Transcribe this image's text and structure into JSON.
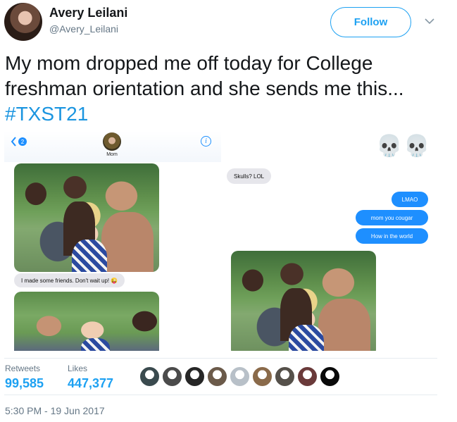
{
  "user": {
    "display_name": "Avery Leilani",
    "handle": "@Avery_Leilani",
    "avatar_icon": "profile-photo"
  },
  "follow_button": {
    "label": "Follow"
  },
  "caret_icon": "chevron-down-icon",
  "tweet": {
    "text": "My mom dropped me off today for College freshman orientation and she sends me this... ",
    "hashtag": "#TXST21"
  },
  "media": {
    "left_screenshot": {
      "back_badge": "2",
      "contact_name": "Mom",
      "info_icon": "i",
      "message": "I made some friends. Don't wait up! 😜"
    },
    "right_screenshot": {
      "emoji_reply": "💀💀",
      "received": "Skulls? LOL",
      "sent": [
        "LMAO",
        "mom you cougar",
        "How in the world"
      ]
    }
  },
  "stats": {
    "retweets_label": "Retweets",
    "retweets_value": "99,585",
    "likes_label": "Likes",
    "likes_value": "447,377"
  },
  "likers": [
    {
      "color": "#3a4a4e"
    },
    {
      "color": "#4b4b4b"
    },
    {
      "color": "#262626"
    },
    {
      "color": "#6b5a4a"
    },
    {
      "color": "#b8c0c8"
    },
    {
      "color": "#8a6a4a"
    },
    {
      "color": "#55504a"
    },
    {
      "color": "#6a3a3a"
    },
    {
      "color": "#0a0a0a"
    }
  ],
  "timestamp": "5:30 PM - 19 Jun 2017",
  "colors": {
    "accent": "#1da1f2",
    "hashtag": "#1b95e0",
    "imessage_blue": "#1e8fff"
  }
}
